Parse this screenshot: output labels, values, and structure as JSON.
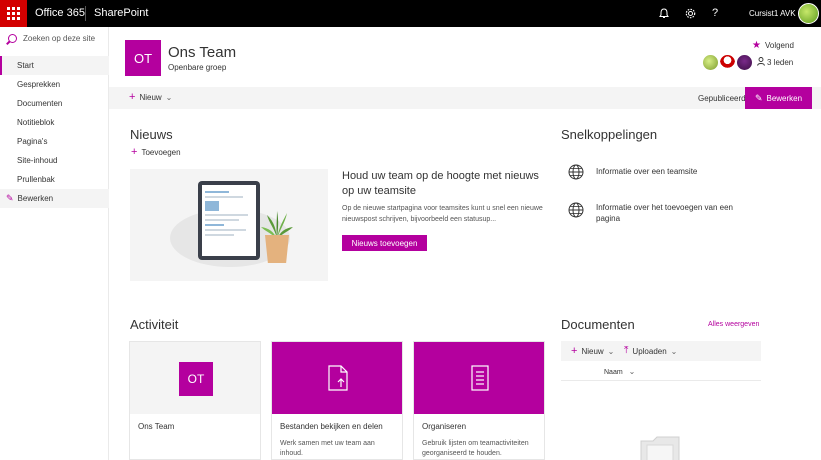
{
  "suitebar": {
    "app_name": "Office 365",
    "product": "SharePoint",
    "user_name": "Cursist1 AVK",
    "icons": [
      "waffle-icon",
      "bell-icon",
      "gear-icon",
      "help-icon"
    ],
    "bell": "🔔",
    "gear": "⚙",
    "help": "?"
  },
  "search": {
    "placeholder": "Zoeken op deze site"
  },
  "nav": {
    "items": [
      {
        "label": "Start"
      },
      {
        "label": "Gesprekken"
      },
      {
        "label": "Documenten"
      },
      {
        "label": "Notitieblok"
      },
      {
        "label": "Pagina's"
      },
      {
        "label": "Site-inhoud"
      },
      {
        "label": "Prullenbak"
      }
    ],
    "edit_label": "Bewerken"
  },
  "header": {
    "logo": "OT",
    "title": "Ons Team",
    "subtitle": "Openbare groep",
    "follow_label": "Volgend",
    "members_label": "3 leden"
  },
  "commandbar": {
    "new_label": "Nieuw",
    "status": "Gepubliceerd",
    "edit_label": "Bewerken"
  },
  "news": {
    "title": "Nieuws",
    "add_label": "Toevoegen",
    "headline": "Houd uw team op de hoogte met nieuws op uw teamsite",
    "body": "Op de nieuwe startpagina voor teamsites kunt u snel een nieuwe nieuwspost schrijven, bijvoorbeeld een statusup...",
    "button": "Nieuws toevoegen"
  },
  "quicklinks": {
    "title": "Snelkoppelingen",
    "items": [
      {
        "label": "Informatie over een teamsite"
      },
      {
        "label": "Informatie over het toevoegen van een pagina"
      }
    ]
  },
  "activity": {
    "title": "Activiteit",
    "cards": [
      {
        "logo": "OT",
        "title": "Ons Team",
        "desc": ""
      },
      {
        "title": "Bestanden bekijken en delen",
        "desc": "Werk samen met uw team aan inhoud."
      },
      {
        "title": "Organiseren",
        "desc": "Gebruik lijsten om teamactiviteiten georganiseerd te houden."
      }
    ]
  },
  "documents": {
    "title": "Documenten",
    "see_all": "Alles weergeven",
    "new_label": "Nieuw",
    "upload_label": "Uploaden",
    "column_name": "Naam"
  },
  "colors": {
    "accent": "#b4009e",
    "suitebar": "#000000",
    "waffle": "#d30000"
  }
}
